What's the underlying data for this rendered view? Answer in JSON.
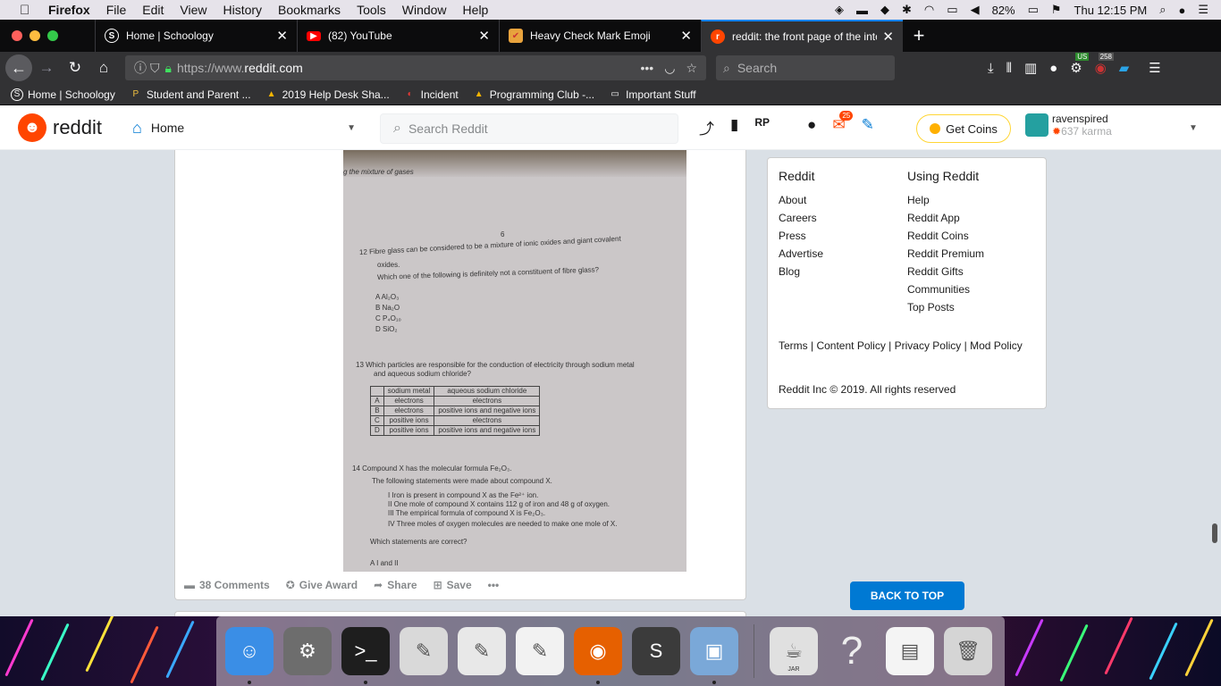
{
  "menubar": {
    "app": "Firefox",
    "items": [
      "File",
      "Edit",
      "View",
      "History",
      "Bookmarks",
      "Tools",
      "Window",
      "Help"
    ],
    "battery": "82%",
    "clock": "Thu 12:15 PM"
  },
  "tabs": [
    {
      "title": "Home | Schoology",
      "favicon": "S"
    },
    {
      "title": "(82) YouTube",
      "favicon": "▶"
    },
    {
      "title": "Heavy Check Mark Emoji",
      "favicon": "✔"
    },
    {
      "title": "reddit: the front page of the inte",
      "favicon": "r"
    }
  ],
  "nav": {
    "url_prefix": "https://www.",
    "url_domain": "reddit.com",
    "search_placeholder": "Search",
    "ext_badge_us": "US",
    "ext_badge_count": "258"
  },
  "bookmarks": [
    {
      "label": "Home | Schoology",
      "icon": "S"
    },
    {
      "label": "Student and Parent ...",
      "icon": "P"
    },
    {
      "label": "2019 Help Desk Sha...",
      "icon": "▲"
    },
    {
      "label": "Incident",
      "icon": "◐"
    },
    {
      "label": "Programming Club -...",
      "icon": "▲"
    },
    {
      "label": "Important Stuff",
      "icon": "▭"
    }
  ],
  "reddit": {
    "logo": "reddit",
    "home": "Home",
    "search_placeholder": "Search Reddit",
    "mail_badge": "25",
    "get_coins": "Get Coins",
    "username": "ravenspired",
    "karma": "637 karma"
  },
  "photo": {
    "top_text": "g the mixture of gases",
    "page_no": "6",
    "q12": "12  Fibre glass can be considered to be a mixture of ionic oxides and giant covalent",
    "q12b": "oxides.",
    "q12c": "Which one of the following is definitely not a constituent of fibre glass?",
    "q12_opts": [
      "A  Al₂O₃",
      "B  Na₂O",
      "C  P₄O₁₀",
      "D  SiO₂"
    ],
    "q13": "13  Which particles are responsible for the conduction of electricity through sodium metal",
    "q13b": "and aqueous sodium chloride?",
    "table_head": [
      "",
      "sodium metal",
      "aqueous sodium chloride"
    ],
    "table_rows": [
      [
        "A",
        "electrons",
        "electrons"
      ],
      [
        "B",
        "electrons",
        "positive ions and negative ions"
      ],
      [
        "C",
        "positive ions",
        "electrons"
      ],
      [
        "D",
        "positive ions",
        "positive ions and negative ions"
      ]
    ],
    "q14": "14  Compound X has the molecular formula Fe₂O₃.",
    "q14b": "The following statements were made about compound X.",
    "q14_stmts": [
      "I    Iron is present in compound X as the Fe²⁺ ion.",
      "II   One mole of compound X contains 112 g of iron and 48 g of oxygen.",
      "III  The empirical formula of compound X is Fe₂O₃.",
      "IV   Three moles of oxygen molecules are needed to make one mole of X."
    ],
    "q14c": "Which statements are correct?",
    "q14_optA": "A   I and II"
  },
  "post_actions": {
    "comments": "38 Comments",
    "award": "Give Award",
    "share": "Share",
    "save": "Save",
    "more": "•••"
  },
  "sidebar": {
    "col1_head": "Reddit",
    "col1": [
      "About",
      "Careers",
      "Press",
      "Advertise",
      "Blog"
    ],
    "col2_head": "Using Reddit",
    "col2": [
      "Help",
      "Reddit App",
      "Reddit Coins",
      "Reddit Premium",
      "Reddit Gifts",
      "Communities",
      "Top Posts"
    ],
    "legal": "Terms  |  Content Policy  |  Privacy Policy  |  Mod Policy",
    "copyright": "Reddit Inc © 2019. All rights reserved"
  },
  "back_to_top": "BACK TO TOP",
  "dock": [
    {
      "name": "finder-icon",
      "glyph": "☺",
      "color": "#3a8ee6"
    },
    {
      "name": "system-preferences-icon",
      "glyph": "⚙",
      "color": "#6d6d6d"
    },
    {
      "name": "terminal-icon",
      "glyph": ">_",
      "color": "#1e1e1e"
    },
    {
      "name": "script-editor-icon",
      "glyph": "✎",
      "color": "#d9d9d9"
    },
    {
      "name": "textedit-icon",
      "glyph": "✎",
      "color": "#e8e8e8"
    },
    {
      "name": "notes-icon",
      "glyph": "✎",
      "color": "#f2f2f2"
    },
    {
      "name": "firefox-icon",
      "glyph": "◉",
      "color": "#e66000"
    },
    {
      "name": "sublime-text-icon",
      "glyph": "S",
      "color": "#3b3b3b"
    },
    {
      "name": "preview-icon",
      "glyph": "▣",
      "color": "#7aa8d8"
    },
    {
      "name": "jar-launcher-icon",
      "glyph": "☕",
      "color": "#e0e0e0"
    },
    {
      "name": "help-icon",
      "glyph": "?",
      "color": "transparent"
    },
    {
      "name": "screen-icon",
      "glyph": "▤",
      "color": "#f4f4f4"
    },
    {
      "name": "trash-icon",
      "glyph": "🗑",
      "color": "#d5d5d5"
    }
  ],
  "dock_jar_label": "JAR"
}
